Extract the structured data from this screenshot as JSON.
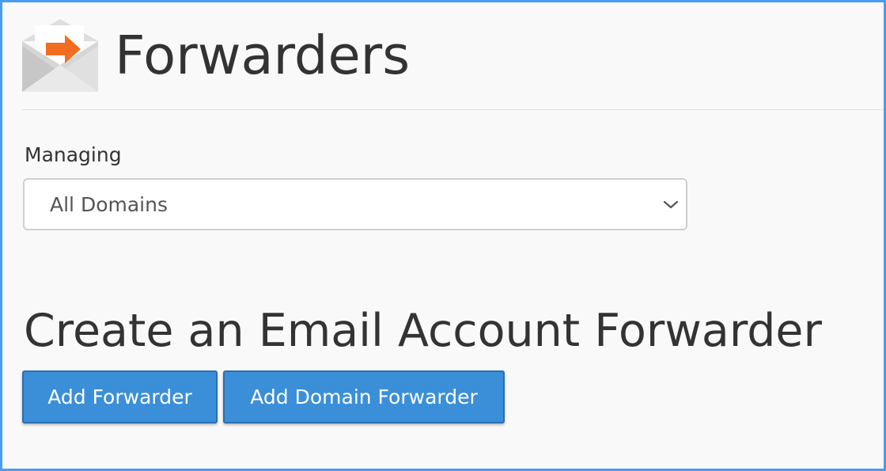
{
  "header": {
    "title": "Forwarders",
    "icon": "envelope-forward-icon"
  },
  "managing": {
    "label": "Managing",
    "selected": "All Domains"
  },
  "section": {
    "title": "Create an Email Account Forwarder"
  },
  "buttons": {
    "add_forwarder": "Add Forwarder",
    "add_domain_forwarder": "Add Domain Forwarder"
  },
  "colors": {
    "accent": "#3b8fd8",
    "icon_arrow": "#f26d21",
    "frame_border": "#4a9cf0"
  }
}
